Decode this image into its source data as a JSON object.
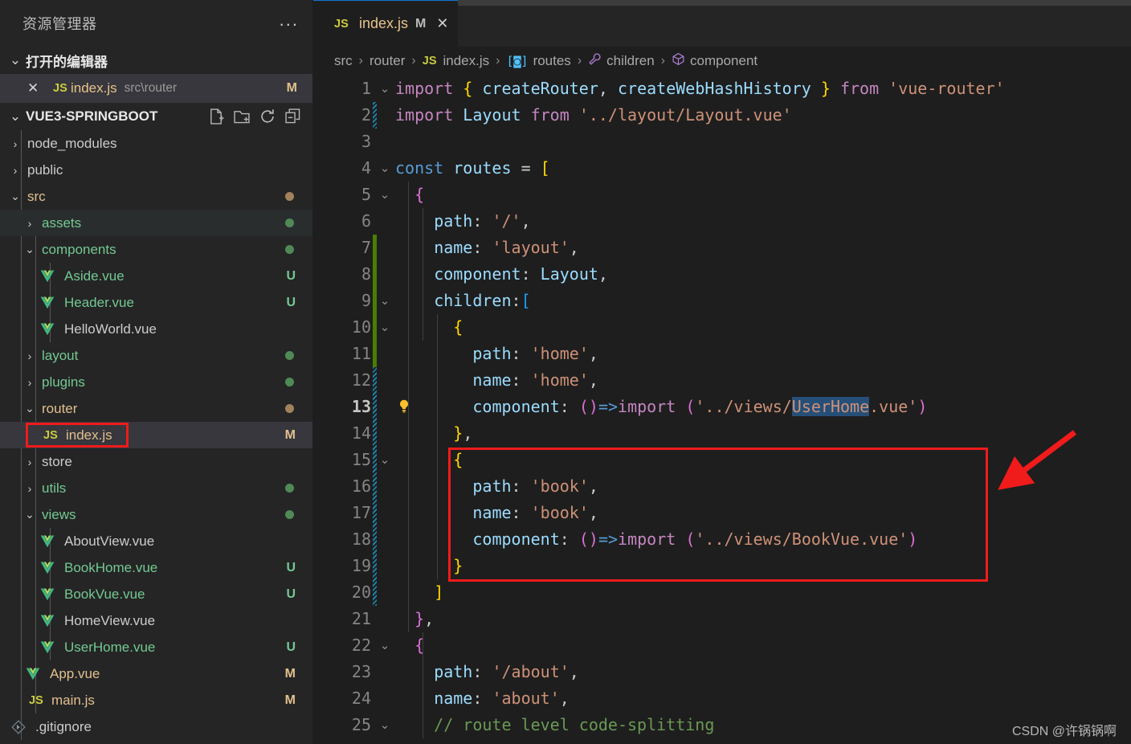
{
  "sidebar": {
    "title": "资源管理器",
    "more_label": "...",
    "open_editors": {
      "label": "打开的编辑器",
      "items": [
        {
          "close": "✕",
          "icon": "JS",
          "name": "index.js",
          "path": "src\\router",
          "status": "M"
        }
      ]
    },
    "project": {
      "label": "VUE3-SPRINGBOOT",
      "actions": [
        "new-file",
        "new-folder",
        "refresh",
        "collapse-all"
      ]
    },
    "tree": [
      {
        "label": "node_modules",
        "type": "folder",
        "state": "collapsed",
        "depth": 1,
        "color": "#cccccc",
        "badge": "",
        "dot": ""
      },
      {
        "label": "public",
        "type": "folder",
        "state": "collapsed",
        "depth": 1,
        "color": "#cccccc",
        "badge": "",
        "dot": ""
      },
      {
        "label": "src",
        "type": "folder",
        "state": "expanded",
        "depth": 1,
        "color": "#e2c08d",
        "badge": "",
        "dot": "#a1825c"
      },
      {
        "label": "assets",
        "type": "folder",
        "state": "collapsed",
        "depth": 2,
        "color": "#73c991",
        "badge": "",
        "dot": "#4f8a56"
      },
      {
        "label": "components",
        "type": "folder",
        "state": "expanded",
        "depth": 2,
        "color": "#73c991",
        "badge": "",
        "dot": "#4f8a56"
      },
      {
        "label": "Aside.vue",
        "type": "vue",
        "depth": 3,
        "color": "#73c991",
        "badge": "U",
        "badgeColor": "#73c991",
        "dot": ""
      },
      {
        "label": "Header.vue",
        "type": "vue",
        "depth": 3,
        "color": "#73c991",
        "badge": "U",
        "badgeColor": "#73c991",
        "dot": ""
      },
      {
        "label": "HelloWorld.vue",
        "type": "vue",
        "depth": 3,
        "color": "#cccccc",
        "badge": "",
        "dot": ""
      },
      {
        "label": "layout",
        "type": "folder",
        "state": "collapsed",
        "depth": 2,
        "color": "#73c991",
        "badge": "",
        "dot": "#4f8a56"
      },
      {
        "label": "plugins",
        "type": "folder",
        "state": "collapsed",
        "depth": 2,
        "color": "#73c991",
        "badge": "",
        "dot": "#4f8a56"
      },
      {
        "label": "router",
        "type": "folder",
        "state": "expanded",
        "depth": 2,
        "color": "#e2c08d",
        "badge": "",
        "dot": "#a1825c"
      },
      {
        "label": "index.js",
        "type": "js",
        "depth": 3,
        "color": "#e2c08d",
        "badge": "M",
        "badgeColor": "#e2c08d",
        "dot": "",
        "selected": true,
        "annotated": true
      },
      {
        "label": "store",
        "type": "folder",
        "state": "collapsed",
        "depth": 2,
        "color": "#cccccc",
        "badge": "",
        "dot": ""
      },
      {
        "label": "utils",
        "type": "folder",
        "state": "collapsed",
        "depth": 2,
        "color": "#73c991",
        "badge": "",
        "dot": "#4f8a56"
      },
      {
        "label": "views",
        "type": "folder",
        "state": "expanded",
        "depth": 2,
        "color": "#73c991",
        "badge": "",
        "dot": "#4f8a56"
      },
      {
        "label": "AboutView.vue",
        "type": "vue",
        "depth": 3,
        "color": "#cccccc",
        "badge": "",
        "dot": ""
      },
      {
        "label": "BookHome.vue",
        "type": "vue",
        "depth": 3,
        "color": "#73c991",
        "badge": "U",
        "badgeColor": "#73c991",
        "dot": ""
      },
      {
        "label": "BookVue.vue",
        "type": "vue",
        "depth": 3,
        "color": "#73c991",
        "badge": "U",
        "badgeColor": "#73c991",
        "dot": ""
      },
      {
        "label": "HomeView.vue",
        "type": "vue",
        "depth": 3,
        "color": "#cccccc",
        "badge": "",
        "dot": ""
      },
      {
        "label": "UserHome.vue",
        "type": "vue",
        "depth": 3,
        "color": "#73c991",
        "badge": "U",
        "badgeColor": "#73c991",
        "dot": ""
      },
      {
        "label": "App.vue",
        "type": "vue",
        "depth": 2,
        "color": "#e2c08d",
        "badge": "M",
        "badgeColor": "#e2c08d",
        "dot": ""
      },
      {
        "label": "main.js",
        "type": "js",
        "depth": 2,
        "color": "#e2c08d",
        "badge": "M",
        "badgeColor": "#e2c08d",
        "dot": ""
      },
      {
        "label": ".gitignore",
        "type": "git",
        "depth": 1,
        "color": "#cccccc",
        "badge": "",
        "dot": ""
      }
    ]
  },
  "editor": {
    "tab": {
      "icon": "JS",
      "name": "index.js",
      "dirty": "M",
      "close": "✕"
    },
    "breadcrumb": [
      {
        "label": "src",
        "icon": ""
      },
      {
        "label": "router",
        "icon": ""
      },
      {
        "label": "index.js",
        "icon": "js"
      },
      {
        "label": "routes",
        "icon": "array"
      },
      {
        "label": "children",
        "icon": "property"
      },
      {
        "label": "component",
        "icon": "variable"
      }
    ],
    "separator": "›",
    "current_line": 13,
    "selected_word": "UserHome",
    "lines": [
      {
        "n": 1,
        "fold": "v",
        "gutter": ""
      },
      {
        "n": 2,
        "fold": "",
        "gutter": "mod"
      },
      {
        "n": 3,
        "fold": "",
        "gutter": ""
      },
      {
        "n": 4,
        "fold": "v",
        "gutter": ""
      },
      {
        "n": 5,
        "fold": "v",
        "gutter": ""
      },
      {
        "n": 6,
        "fold": "",
        "gutter": ""
      },
      {
        "n": 7,
        "fold": "",
        "gutter": "add"
      },
      {
        "n": 8,
        "fold": "",
        "gutter": "add"
      },
      {
        "n": 9,
        "fold": "v",
        "gutter": "add"
      },
      {
        "n": 10,
        "fold": "v",
        "gutter": "add"
      },
      {
        "n": 11,
        "fold": "",
        "gutter": "add"
      },
      {
        "n": 12,
        "fold": "",
        "gutter": "mod"
      },
      {
        "n": 13,
        "fold": "",
        "gutter": "mod",
        "bulb": true
      },
      {
        "n": 14,
        "fold": "",
        "gutter": "mod"
      },
      {
        "n": 15,
        "fold": "v",
        "gutter": "mod"
      },
      {
        "n": 16,
        "fold": "",
        "gutter": "mod"
      },
      {
        "n": 17,
        "fold": "",
        "gutter": "mod"
      },
      {
        "n": 18,
        "fold": "",
        "gutter": "mod"
      },
      {
        "n": 19,
        "fold": "",
        "gutter": "mod"
      },
      {
        "n": 20,
        "fold": "",
        "gutter": "mod"
      },
      {
        "n": 21,
        "fold": "",
        "gutter": ""
      },
      {
        "n": 22,
        "fold": "v",
        "gutter": ""
      },
      {
        "n": 23,
        "fold": "",
        "gutter": ""
      },
      {
        "n": 24,
        "fold": "",
        "gutter": ""
      },
      {
        "n": 25,
        "fold": "v",
        "gutter": ""
      }
    ],
    "source_lines": [
      "import { createRouter, createWebHashHistory } from 'vue-router'",
      "import Layout from '../layout/Layout.vue'",
      "",
      "const routes = [",
      "  {",
      "    path: '/',",
      "    name: 'layout',",
      "    component: Layout,",
      "    children:[",
      "      {",
      "        path: 'home',",
      "        name: 'home',",
      "        component: ()=>import ('../views/UserHome.vue')",
      "      },",
      "      {",
      "        path: 'book',",
      "        name: 'book',",
      "        component: ()=>import ('../views/BookVue.vue')",
      "      }",
      "    ]",
      "  },",
      "  {",
      "    path: '/about',",
      "    name: 'about',",
      "    // route level code-splitting"
    ]
  },
  "annotations": {
    "highlight_box_label": "book-route-highlight",
    "sidebar_box_label": "index-js-highlight",
    "arrow_label": "red-arrow-pointer",
    "arrow_color": "#f01b1b",
    "box_color": "#f01b1b"
  },
  "watermark": {
    "text": "CSDN @许锅锅啊"
  }
}
